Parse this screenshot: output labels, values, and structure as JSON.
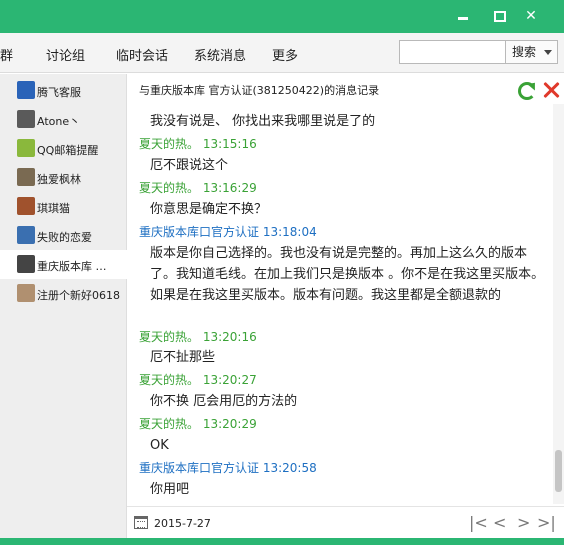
{
  "window": {
    "min_label": "",
    "max_label": "",
    "close_label": "✕"
  },
  "nav": {
    "items": [
      "群",
      "讨论组",
      "临时会话",
      "系统消息",
      "更多"
    ],
    "search_placeholder": "",
    "search_button": "搜索"
  },
  "sidebar": {
    "items": [
      {
        "label": "腾飞客服",
        "avatar_color": "#2a63b8"
      },
      {
        "label": "Atone丶",
        "avatar_color": "#5a5a5a"
      },
      {
        "label": "QQ邮箱提醒",
        "avatar_color": "#8ab83c"
      },
      {
        "label": "独爱枫林",
        "avatar_color": "#7a6a52"
      },
      {
        "label": "琪琪猫",
        "avatar_color": "#a0522d"
      },
      {
        "label": "失败的恋爱",
        "avatar_color": "#3a6fb0"
      },
      {
        "label": "重庆版本库 …",
        "avatar_color": "#444444"
      },
      {
        "label": "注册个新好0618",
        "avatar_color": "#b09070"
      }
    ]
  },
  "chat": {
    "title": "与重庆版本库  官方认证(381250422)的消息记录",
    "messages": [
      {
        "kind": "text",
        "text": "我没有说是、 你找出来我哪里说是了的"
      },
      {
        "kind": "meta",
        "color": "green",
        "text": "夏天的热。 13:15:16"
      },
      {
        "kind": "text",
        "text": "厄不跟说这个"
      },
      {
        "kind": "meta",
        "color": "green",
        "text": "夏天的热。 13:16:29"
      },
      {
        "kind": "text",
        "text": "你意思是确定不换？"
      },
      {
        "kind": "meta",
        "color": "blue",
        "text": "重庆版本库口官方认证 13:18:04"
      },
      {
        "kind": "text",
        "text": "版本是你自己选择的。我也没有说是完整的。再加上这么久的版本了。我知道毛线。在加上我们只是换版本 。你不是在我这里买版本。如果是在我这里买版本。版本有问题。我这里都是全额退款的"
      },
      {
        "kind": "meta",
        "color": "green",
        "text": "夏天的热。 13:20:16"
      },
      {
        "kind": "text",
        "text": "厄不扯那些"
      },
      {
        "kind": "meta",
        "color": "green",
        "text": "夏天的热。 13:20:27"
      },
      {
        "kind": "text",
        "text": "你不换 厄会用厄的方法的"
      },
      {
        "kind": "meta",
        "color": "green",
        "text": "夏天的热。 13:20:29"
      },
      {
        "kind": "text",
        "text": "OK"
      },
      {
        "kind": "meta",
        "color": "blue",
        "text": "重庆版本库口官方认证 13:20:58"
      },
      {
        "kind": "text",
        "text": "你用吧"
      }
    ]
  },
  "footer": {
    "date": "2015-7-27",
    "first_label": "|<",
    "prev_label": "<",
    "next_label": ">",
    "last_label": ">|"
  },
  "colors": {
    "titlebar": "#2bb673",
    "meta_green": "#3aa236",
    "meta_blue": "#1e6fc2"
  }
}
